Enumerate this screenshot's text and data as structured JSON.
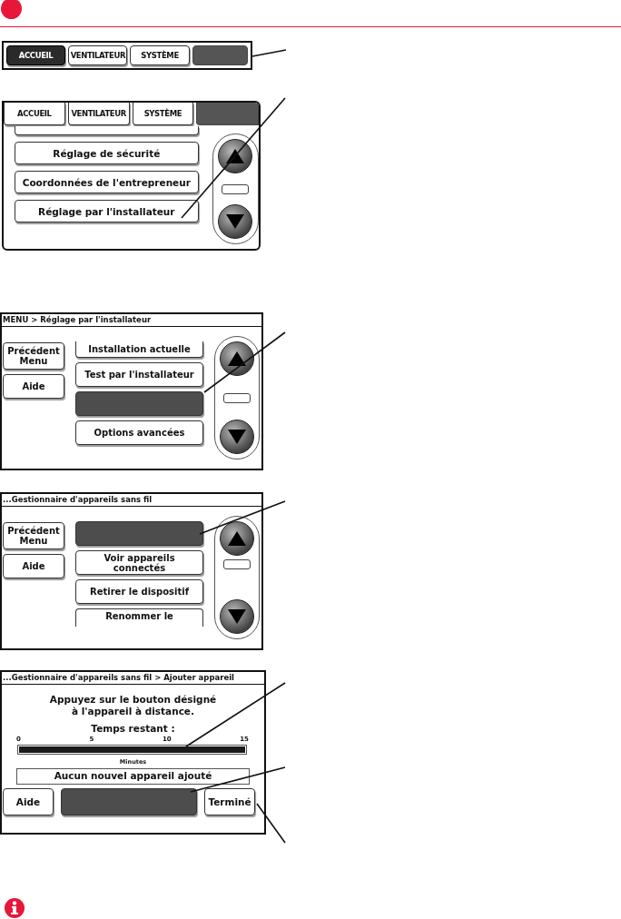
{
  "screens": [
    {
      "kind": "tabbar",
      "tabs": [
        {
          "kind": "tab",
          "label": "ACCUEIL",
          "selected": true
        },
        {
          "kind": "tab",
          "label": "VENTILATEUR",
          "selected": false
        },
        {
          "kind": "tab",
          "label": "SYSTÈME",
          "selected": false
        },
        {
          "kind": "blank"
        }
      ]
    },
    {
      "kind": "menu",
      "tabs": [
        {
          "kind": "tab",
          "label": "ACCUEIL",
          "selected": false
        },
        {
          "kind": "tab",
          "label": "VENTILATEUR",
          "selected": false
        },
        {
          "kind": "tab",
          "label": "SYSTÈME",
          "selected": false
        },
        {
          "kind": "blank"
        }
      ],
      "items": [
        {
          "kind": "cut"
        },
        {
          "kind": "button",
          "label": "Réglage de sécurité"
        },
        {
          "kind": "button",
          "label": "Coordonnées de l'entrepreneur"
        },
        {
          "kind": "button",
          "label": "Réglage par l'installateur"
        }
      ]
    },
    {
      "kind": "submenu",
      "title": "MENU > Réglage par l'installateur",
      "side_buttons": [
        "Précédent Menu",
        "Aide"
      ],
      "items": [
        {
          "kind": "top",
          "label": "Installation actuelle"
        },
        {
          "kind": "button",
          "label": "Test par l'installateur"
        },
        {
          "kind": "blank"
        },
        {
          "kind": "button",
          "label": "Options avancées"
        }
      ]
    },
    {
      "kind": "submenu",
      "title": "...Gestionnaire d'appareils sans fil",
      "side_buttons": [
        "Précédent Menu",
        "Aide"
      ],
      "items": [
        {
          "kind": "blank"
        },
        {
          "kind": "button",
          "label": "Voir appareils connectés"
        },
        {
          "kind": "button",
          "label": "Retirer le dispositif"
        },
        {
          "kind": "bottom",
          "label": "Renommer le"
        }
      ]
    },
    {
      "kind": "progress",
      "title": "...Gestionnaire d'appareils sans fil > Ajouter appareil",
      "message": [
        "Appuyez sur le bouton désigné",
        "à l'appareil à distance."
      ],
      "timer_label": "Temps restant :",
      "scale": [
        "0",
        "5",
        "10",
        "15"
      ],
      "level": 1,
      "unit": "Minutes",
      "status": "Aucun nouvel appareil ajouté",
      "buttons": [
        {
          "kind": "button",
          "label": "Aide"
        },
        {
          "kind": "blank"
        },
        {
          "kind": "button",
          "label": "Terminé"
        }
      ]
    }
  ]
}
